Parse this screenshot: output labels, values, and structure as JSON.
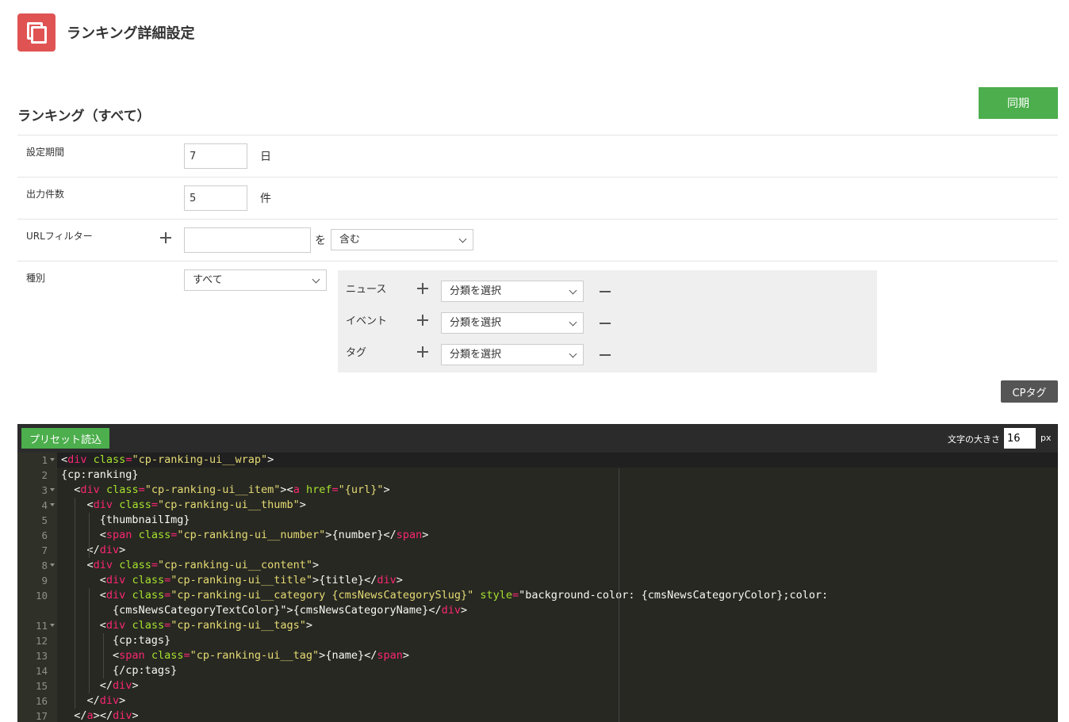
{
  "header": {
    "title": "ランキング詳細設定",
    "icon": "copy-pages-icon",
    "accent": "#e05353"
  },
  "section": {
    "title": "ランキング（すべて）",
    "sync_label": "同期",
    "sync_color": "#4cae4c"
  },
  "form": {
    "period": {
      "label": "設定期間",
      "value": "7",
      "unit": "日"
    },
    "count": {
      "label": "出力件数",
      "value": "5",
      "unit": "件"
    },
    "url_filter": {
      "label": "URLフィルター",
      "value": "",
      "connector": "を",
      "mode": "含む"
    },
    "type": {
      "label": "種別",
      "selected": "すべて",
      "categories": [
        {
          "label": "ニュース",
          "select": "分類を選択"
        },
        {
          "label": "イベント",
          "select": "分類を選択"
        },
        {
          "label": "タグ",
          "select": "分類を選択"
        }
      ]
    }
  },
  "cptag_label": "CPタグ",
  "editor": {
    "preset_label": "プリセット読込",
    "font_size_label": "文字の大きさ",
    "font_size_value": "16",
    "font_unit": "px",
    "line_numbers": [
      "1",
      "2",
      "3",
      "4",
      "5",
      "6",
      "7",
      "8",
      "9",
      "10",
      "",
      "11",
      "12",
      "13",
      "14",
      "15",
      "16",
      "17"
    ],
    "lines": [
      "<div class=\"cp-ranking-ui__wrap\">",
      "{cp:ranking}",
      "  <div class=\"cp-ranking-ui__item\"><a href=\"{url}\">",
      "    <div class=\"cp-ranking-ui__thumb\">",
      "      {thumbnailImg}",
      "      <span class=\"cp-ranking-ui__number\">{number}</span>",
      "    </div>",
      "    <div class=\"cp-ranking-ui__content\">",
      "      <div class=\"cp-ranking-ui__title\">{title}</div>",
      "      <div class=\"cp-ranking-ui__category {cmsNewsCategorySlug}\" style=\"background-color: {cmsNewsCategoryColor};color:",
      "        {cmsNewsCategoryTextColor}\">{cmsNewsCategoryName}</div>",
      "      <div class=\"cp-ranking-ui__tags\">",
      "        {cp:tags}",
      "        <span class=\"cp-ranking-ui__tag\">{name}</span>",
      "        {/cp:tags}",
      "      </div>",
      "    </div>",
      "  </a></div>"
    ]
  }
}
